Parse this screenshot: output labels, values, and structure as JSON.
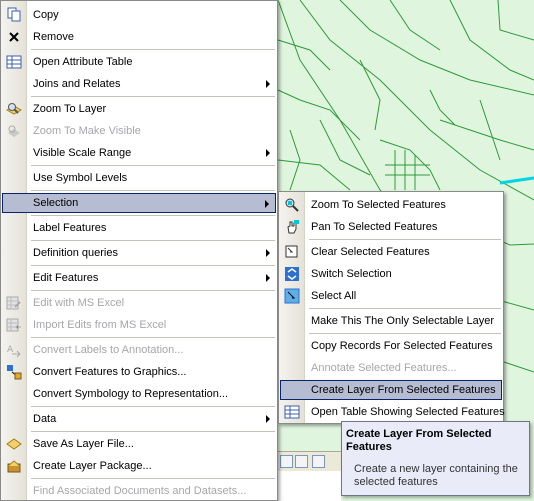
{
  "context_menu": {
    "items": [
      {
        "label": "Copy",
        "icon": "copy-icon"
      },
      {
        "label": "Remove",
        "icon": "remove-icon"
      },
      {
        "label": "Open Attribute Table",
        "icon": "table-icon"
      },
      {
        "label": "Joins and Relates"
      },
      {
        "label": "Zoom To Layer",
        "icon": "zoom-layer-icon"
      },
      {
        "label": "Zoom To Make Visible"
      },
      {
        "label": "Visible Scale Range"
      },
      {
        "label": "Use Symbol Levels"
      },
      {
        "label": "Selection"
      },
      {
        "label": "Label Features"
      },
      {
        "label": "Definition queries"
      },
      {
        "label": "Edit Features"
      },
      {
        "label": "Edit with MS Excel",
        "icon": "excel-edit-icon"
      },
      {
        "label": "Import Edits from MS Excel",
        "icon": "excel-import-icon"
      },
      {
        "label": "Convert Labels to Annotation...",
        "icon": "convert-labels-icon"
      },
      {
        "label": "Convert Features to Graphics...",
        "icon": "convert-graphics-icon"
      },
      {
        "label": "Convert Symbology to Representation..."
      },
      {
        "label": "Data"
      },
      {
        "label": "Save As Layer File...",
        "icon": "layer-file-icon"
      },
      {
        "label": "Create Layer Package...",
        "icon": "layer-package-icon"
      },
      {
        "label": "Find Associated Documents and Datasets..."
      }
    ]
  },
  "selection_submenu": {
    "items": [
      {
        "label": "Zoom To Selected Features",
        "icon": "zoom-selected-icon"
      },
      {
        "label": "Pan To Selected Features",
        "icon": "pan-selected-icon"
      },
      {
        "label": "Clear Selected Features",
        "icon": "clear-selection-icon"
      },
      {
        "label": "Switch Selection",
        "icon": "switch-selection-icon"
      },
      {
        "label": "Select All",
        "icon": "select-all-icon"
      },
      {
        "label": "Make This The Only Selectable Layer"
      },
      {
        "label": "Copy Records For Selected Features"
      },
      {
        "label": "Annotate Selected Features..."
      },
      {
        "label": "Create Layer From Selected Features"
      },
      {
        "label": "Open Table Showing Selected Features",
        "icon": "table-icon"
      }
    ]
  },
  "tooltip": {
    "title": "Create Layer From Selected Features",
    "body": "Create a new layer containing the selected features"
  },
  "colors": {
    "map_background": "#dff5de",
    "map_lines": "#2f9a3a",
    "menu_highlight": "#b6bdd2",
    "menu_highlight_border": "#0a246a",
    "disabled_text": "#a7a6aa",
    "tooltip_background": "#e9ecf8"
  }
}
